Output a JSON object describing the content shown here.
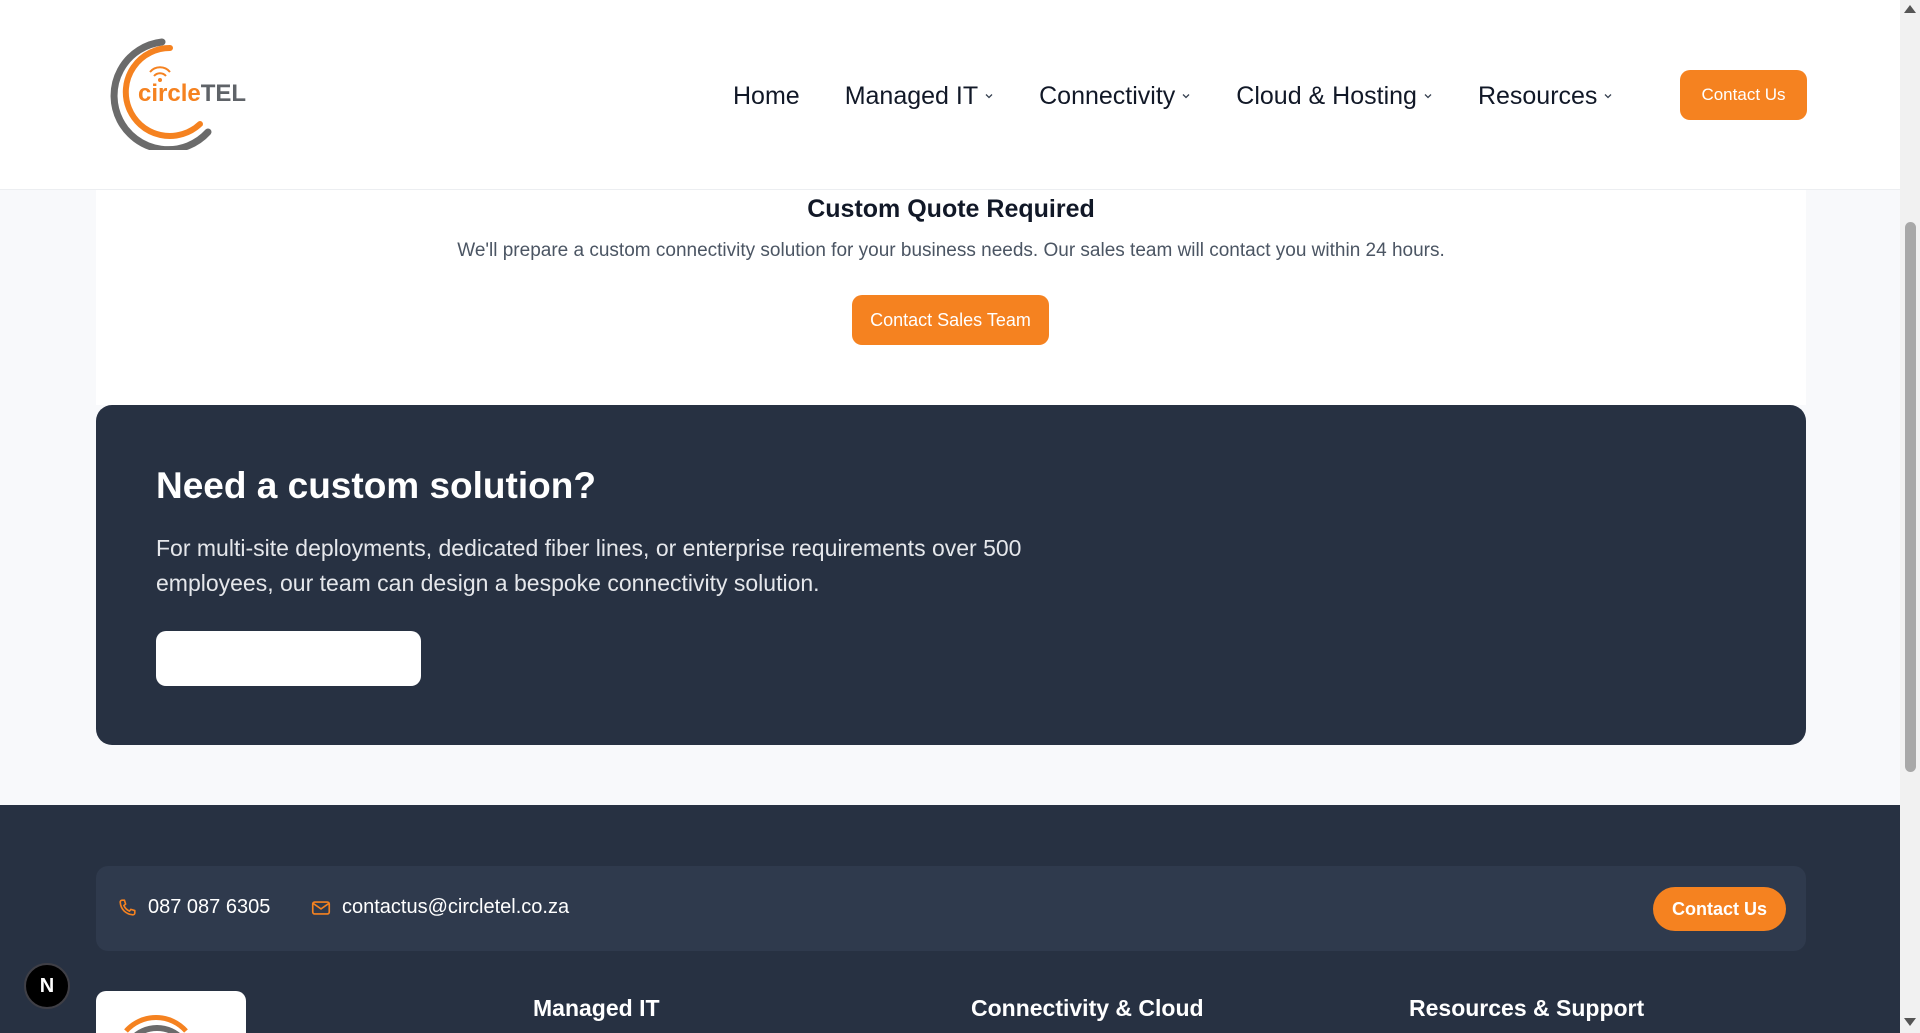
{
  "header": {
    "logo": {
      "text_part1": "circle",
      "text_part2": "TEL"
    },
    "nav": [
      {
        "label": "Home",
        "has_dropdown": false
      },
      {
        "label": "Managed IT",
        "has_dropdown": true
      },
      {
        "label": "Connectivity",
        "has_dropdown": true
      },
      {
        "label": "Cloud & Hosting",
        "has_dropdown": true
      },
      {
        "label": "Resources",
        "has_dropdown": true
      }
    ],
    "contact_button": "Contact Us"
  },
  "quote": {
    "title": "Custom Quote Required",
    "description": "We'll prepare a custom connectivity solution for your business needs. Our sales team will contact you within 24 hours.",
    "button": "Contact Sales Team"
  },
  "custom_solution": {
    "title": "Need a custom solution?",
    "description": "For multi-site deployments, dedicated fiber lines, or enterprise requirements over 500 employees, our team can design a bespoke connectivity solution.",
    "button": ""
  },
  "footer": {
    "phone": "087 087 6305",
    "email": "contactus@circletel.co.za",
    "contact_button": "Contact Us",
    "columns": [
      "Managed IT",
      "Connectivity & Cloud",
      "Resources & Support"
    ]
  },
  "badge": {
    "letter": "N"
  },
  "colors": {
    "accent": "#f58220",
    "dark": "#273142",
    "contact_bar": "#2f3a4d",
    "text_dark": "#111827",
    "text_muted": "#4b5563"
  },
  "icons": {
    "phone": "phone-icon",
    "email": "mail-icon",
    "dropdown": "chevron-down-icon"
  }
}
